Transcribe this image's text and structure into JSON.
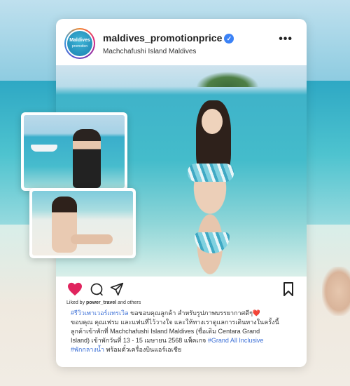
{
  "post": {
    "username": "maldives_promotionprice",
    "location": "Machchafushi Island Maldives",
    "avatar_text": "Maldives",
    "avatar_subtext": "promotion",
    "liked_prefix": "Liked by ",
    "liked_user": "power_travel",
    "liked_suffix": " and others",
    "caption": {
      "tag1": "#รีวิวเพาเวอร์แทรเวิล",
      "text1": " ขอขอบคุณลูกค้า สำหรับรูปภาพบรรยากาศดีๆ❤️",
      "text2": "ขอบคุณ คุณเฟรม และแฟนที่ไว้วางใจ และให้ทางเราดูแลการเดินทางในครั้งนี้",
      "text3": "ลูกค้าเข้าพักที่ Machchafushi Island Maldives (ชื่อเดิม Centara Grand",
      "text4": "Island) เข้าพักวันที่ 13 - 15 เมษายน 2568 แพ็คเกจ ",
      "tag2": "#Grand All Inclusive",
      "tag3": "#พักกลางน้ำ",
      "text5": " พร้อมตั๋วเครื่องบินแอร์เอเชีย"
    }
  },
  "icons": {
    "verified": "verified-badge-icon",
    "more": "more-dots-icon",
    "like": "heart-icon",
    "comment": "comment-icon",
    "share": "send-icon",
    "save": "bookmark-icon"
  },
  "colors": {
    "like": "#e0245e",
    "hashtag": "#3b6fd6",
    "verified": "#3b82f6"
  }
}
